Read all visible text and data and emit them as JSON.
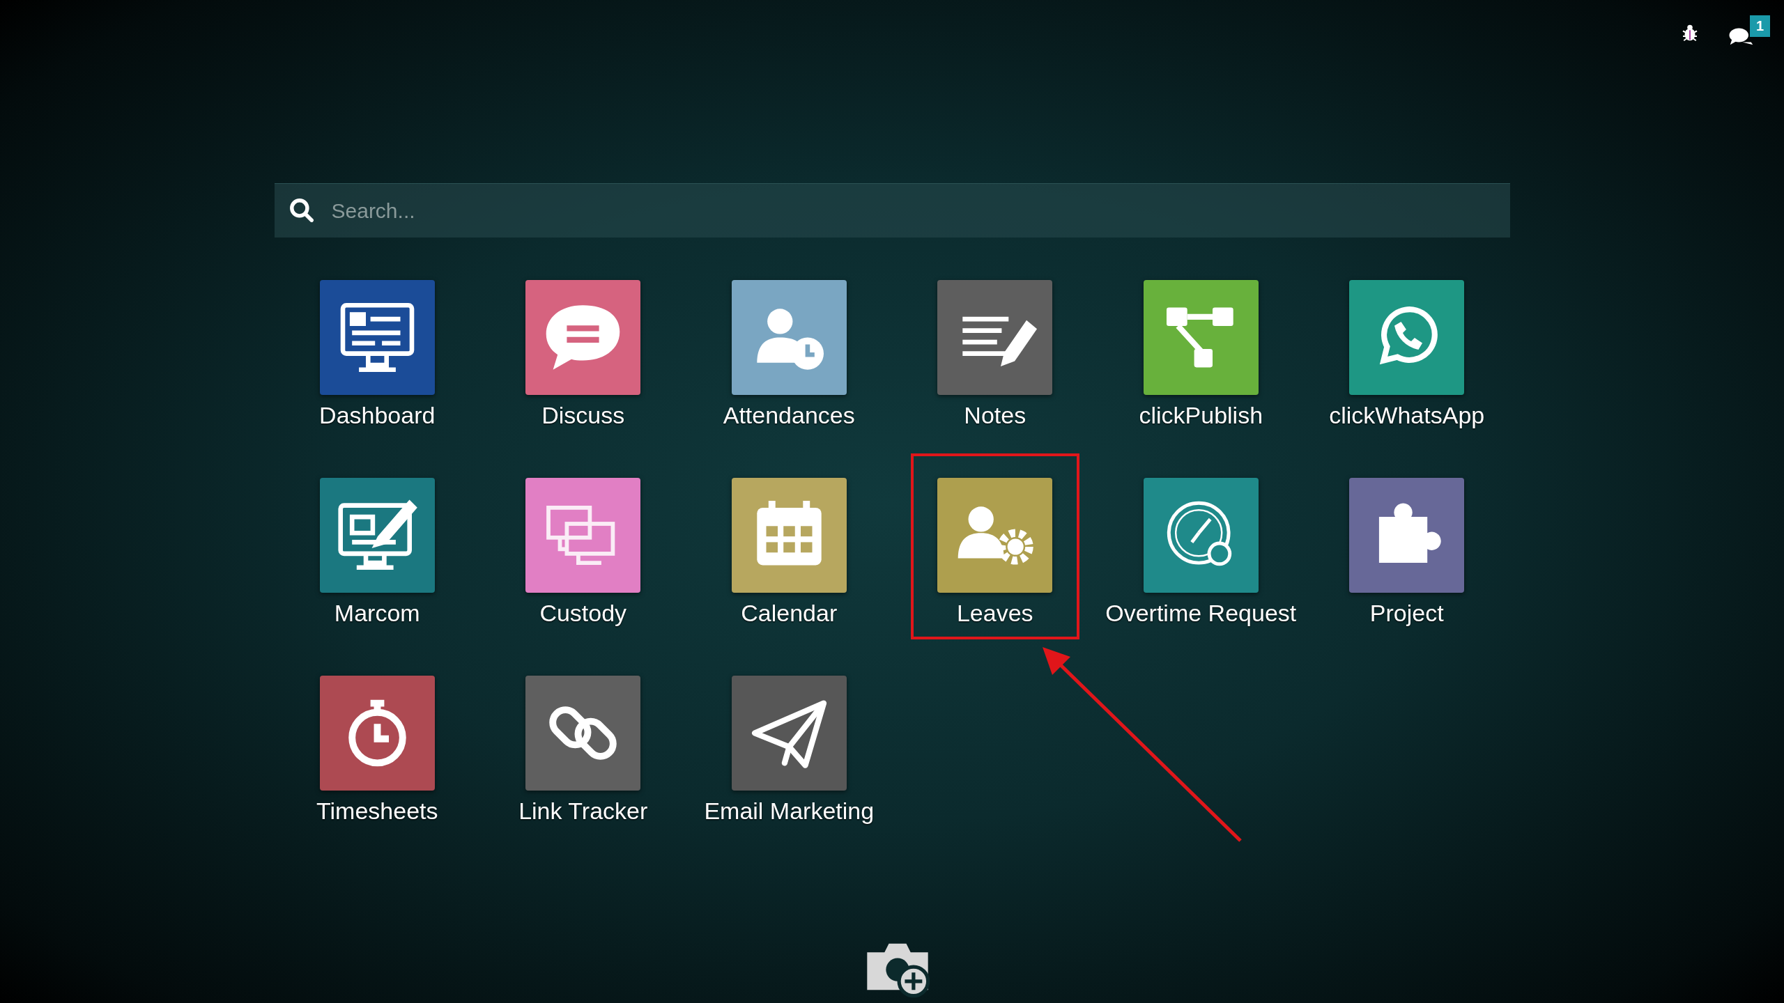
{
  "search": {
    "placeholder": "Search..."
  },
  "systray": {
    "chat_badge": "1"
  },
  "apps": [
    {
      "label": "Dashboard",
      "kind": "dashboard",
      "color": "#1b4c98",
      "highlighted": false
    },
    {
      "label": "Discuss",
      "kind": "discuss",
      "color": "#d6637f",
      "highlighted": false
    },
    {
      "label": "Attendances",
      "kind": "attendances",
      "color": "#7aa6c2",
      "highlighted": false
    },
    {
      "label": "Notes",
      "kind": "notes",
      "color": "#5e5e5e",
      "highlighted": false
    },
    {
      "label": "clickPublish",
      "kind": "publish",
      "color": "#68b13c",
      "highlighted": false
    },
    {
      "label": "clickWhatsApp",
      "kind": "whatsapp",
      "color": "#1e9784",
      "highlighted": false
    },
    {
      "label": "Marcom",
      "kind": "marcom",
      "color": "#1b7880",
      "highlighted": false
    },
    {
      "label": "Custody",
      "kind": "custody",
      "color": "#e17fc4",
      "highlighted": false
    },
    {
      "label": "Calendar",
      "kind": "calendar",
      "color": "#b7a75f",
      "highlighted": false
    },
    {
      "label": "Leaves",
      "kind": "leaves",
      "color": "#ae9f4e",
      "highlighted": true
    },
    {
      "label": "Overtime Request",
      "kind": "overtime",
      "color": "#1f8a8a",
      "highlighted": false
    },
    {
      "label": "Project",
      "kind": "project",
      "color": "#676898",
      "highlighted": false
    },
    {
      "label": "Timesheets",
      "kind": "timesheets",
      "color": "#ad4a52",
      "highlighted": false
    },
    {
      "label": "Link Tracker",
      "kind": "link",
      "color": "#5f5f5f",
      "highlighted": false
    },
    {
      "label": "Email Marketing",
      "kind": "email",
      "color": "#575757",
      "highlighted": false
    }
  ]
}
